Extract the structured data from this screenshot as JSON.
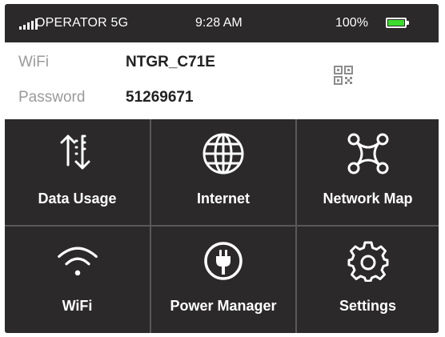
{
  "status_bar": {
    "operator": "OPERATOR 5G",
    "time": "9:28 AM",
    "battery_percent": "100%",
    "battery_level": 1.0,
    "battery_color": "#3ddc2f"
  },
  "wifi_info": {
    "wifi_label": "WiFi",
    "ssid": "NTGR_C71E",
    "password_label": "Password",
    "password": "51269671"
  },
  "tiles": [
    {
      "label": "Data Usage",
      "icon": "data-usage-icon"
    },
    {
      "label": "Internet",
      "icon": "globe-icon"
    },
    {
      "label": "Network Map",
      "icon": "network-map-icon"
    },
    {
      "label": "WiFi",
      "icon": "wifi-icon"
    },
    {
      "label": "Power Manager",
      "icon": "power-plug-icon"
    },
    {
      "label": "Settings",
      "icon": "gear-icon"
    }
  ]
}
